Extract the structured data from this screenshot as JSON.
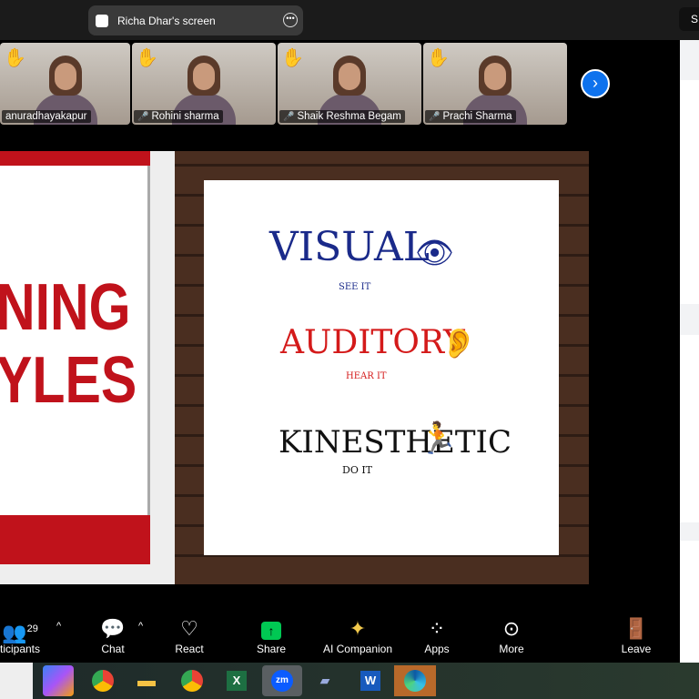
{
  "topbar": {
    "screen_title": "Richa Dhar's screen",
    "right_button": "S"
  },
  "participants": [
    {
      "name": "anuradhayakapur",
      "hand_raised": true,
      "muted": false
    },
    {
      "name": "Rohini sharma",
      "hand_raised": true,
      "muted": true
    },
    {
      "name": "Shaik Reshma Begam",
      "hand_raised": true,
      "muted": true
    },
    {
      "name": "Prachi Sharma",
      "hand_raised": true,
      "muted": true
    }
  ],
  "slide": {
    "left_title_line1": "NING",
    "left_title_line2": "YLES",
    "styles": [
      {
        "word": "VISUAL",
        "sub": "SEE IT",
        "color": "#1a2a8a"
      },
      {
        "word": "AUDITORY",
        "sub": "HEAR IT",
        "color": "#d41a1a"
      },
      {
        "word": "KINESTHETIC",
        "sub": "DO IT",
        "color": "#111111"
      }
    ]
  },
  "toolbar": {
    "participants_label": "ticipants",
    "participants_count": "29",
    "chat": "Chat",
    "react": "React",
    "share": "Share",
    "ai": "AI Companion",
    "apps": "Apps",
    "more": "More",
    "leave": "Leave"
  },
  "taskbar": {
    "apps": [
      "copilot",
      "chrome",
      "file-explorer",
      "chrome-profile",
      "excel",
      "zoom",
      "notepad",
      "word",
      "edge"
    ],
    "zoom_label": "zm",
    "excel_label": "X",
    "word_label": "W"
  },
  "colors": {
    "accent": "#0e72ed",
    "share": "#00c853",
    "leave": "#e0245e"
  }
}
